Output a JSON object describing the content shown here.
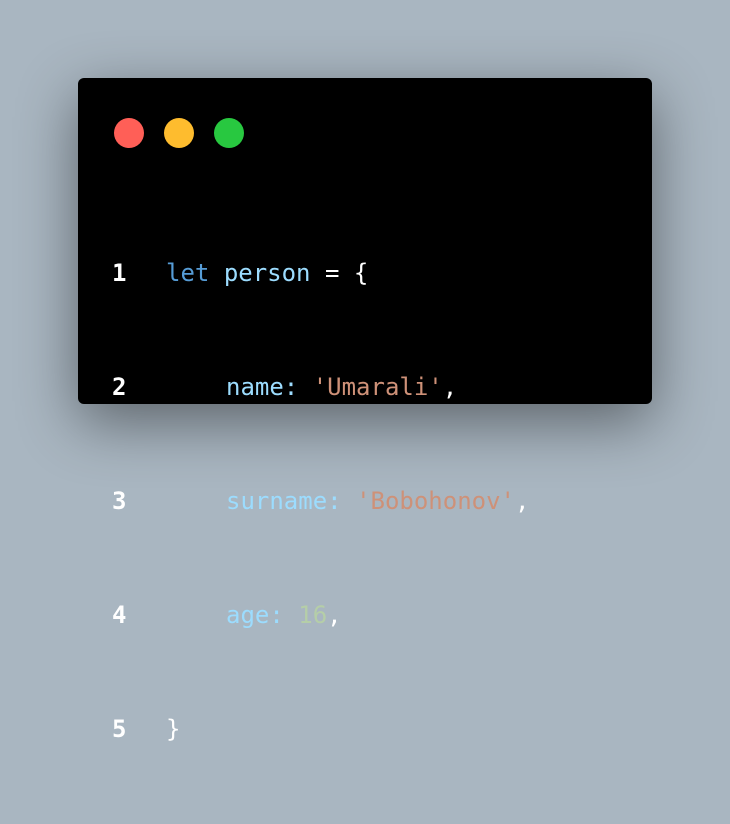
{
  "window": {
    "controls": [
      {
        "name": "close",
        "color": "#ff5f57"
      },
      {
        "name": "minimize",
        "color": "#febc2e"
      },
      {
        "name": "maximize",
        "color": "#28c840"
      }
    ]
  },
  "code": {
    "line_numbers": [
      "1",
      "2",
      "3",
      "4",
      "5"
    ],
    "line1": {
      "kw": "let",
      "id": "person",
      "op": " = ",
      "brace": "{"
    },
    "line2": {
      "key": "name",
      "colon": ": ",
      "value": "'Umarali'",
      "comma": ","
    },
    "line3": {
      "key": "surname",
      "colon": ": ",
      "value": "'Bobohonov'",
      "comma": ","
    },
    "line4": {
      "key": "age",
      "colon": ": ",
      "value": "16",
      "comma": ","
    },
    "line5": {
      "brace": "}"
    }
  },
  "colors": {
    "background": "#a9b6c1",
    "editor_bg": "#000000",
    "keyword": "#569cd6",
    "identifier": "#9cdcfe",
    "string": "#ce9178",
    "number": "#b5cea8",
    "punctuation": "#ffffff"
  }
}
